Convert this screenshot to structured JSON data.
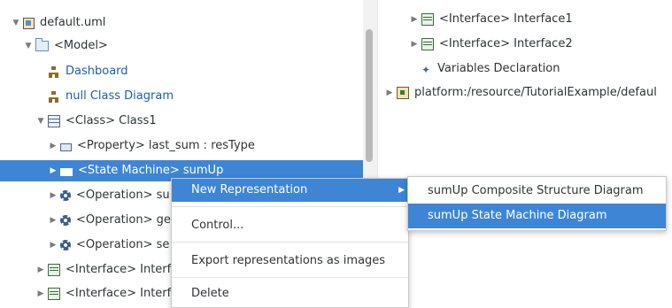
{
  "tree": {
    "root": {
      "label": "default.uml",
      "icon": "uml-file-icon"
    },
    "model": {
      "label": "<Model>",
      "icon": "model-folder-icon"
    },
    "dashboard": {
      "label": "Dashboard",
      "icon": "diagram-icon"
    },
    "null_class_diagram": {
      "label": "null Class Diagram",
      "icon": "diagram-icon"
    },
    "class1": {
      "label": "<Class> Class1",
      "icon": "class-icon"
    },
    "property": {
      "label": "<Property> last_sum : resType",
      "icon": "property-icon"
    },
    "state_machine": {
      "label": "<State Machine> sumUp",
      "icon": "state-machine-icon"
    },
    "operation1": {
      "label": "<Operation> su",
      "icon": "operation-icon"
    },
    "operation2": {
      "label": "<Operation> ge",
      "icon": "operation-icon"
    },
    "operation3": {
      "label": "<Operation> se",
      "icon": "operation-icon"
    },
    "interface_a": {
      "label": "<Interface> Interf",
      "icon": "interface-icon"
    },
    "interface_b": {
      "label": "<Interface> Interf",
      "icon": "interface-icon"
    }
  },
  "right_tree": {
    "interface1": {
      "label": "<Interface> Interface1",
      "icon": "interface-icon"
    },
    "interface2": {
      "label": "<Interface> Interface2",
      "icon": "interface-icon"
    },
    "variables": {
      "label": "Variables Declaration",
      "icon": "variables-icon"
    },
    "platform": {
      "label": "platform:/resource/TutorialExample/defaul",
      "icon": "platform-resource-icon"
    }
  },
  "context_menu": {
    "new_representation": "New Representation",
    "control": "Control...",
    "export": "Export representations as images",
    "delete": "Delete"
  },
  "submenu": {
    "composite": "sumUp Composite Structure Diagram",
    "state_machine_diagram": "sumUp State Machine Diagram"
  },
  "colors": {
    "selection": "#3e85d6",
    "link": "#1d5fa6"
  }
}
